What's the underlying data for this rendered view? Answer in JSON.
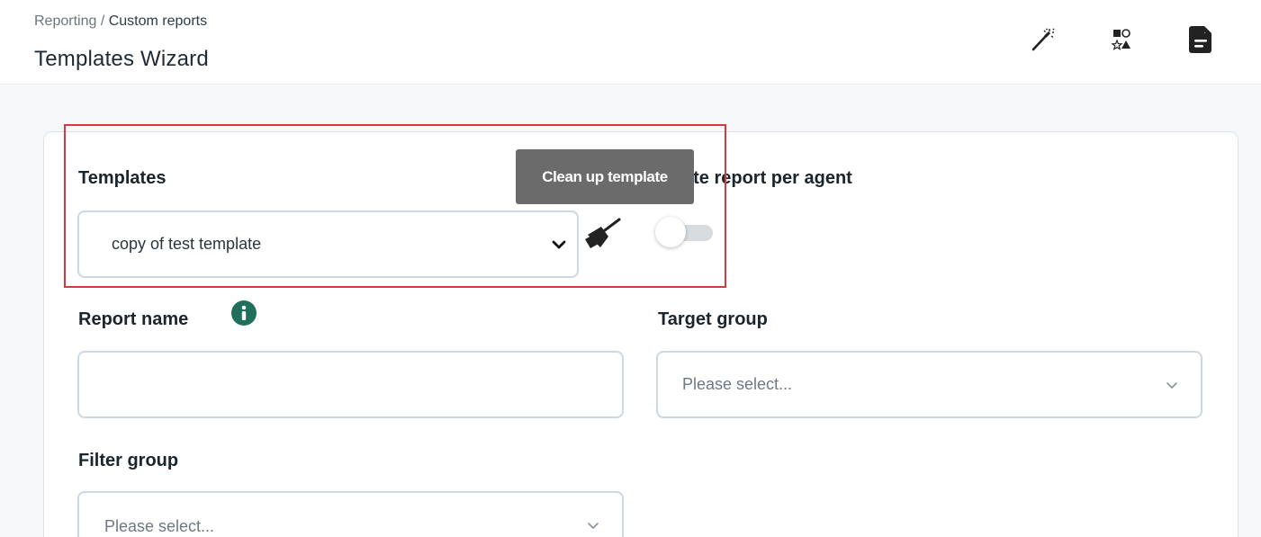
{
  "header": {
    "breadcrumb": {
      "root": "Reporting",
      "separator": " / ",
      "current": "Custom reports"
    },
    "title": "Templates Wizard",
    "toolbar": [
      {
        "icon": "magic-wand-icon"
      },
      {
        "icon": "shapes-icon"
      },
      {
        "icon": "document-icon"
      }
    ]
  },
  "form": {
    "templates": {
      "label": "Templates",
      "selected_value": "copy of test template",
      "cleanup_icon": "broom-icon",
      "cleanup_tooltip": "Clean up template"
    },
    "separate_report": {
      "label_visible": "ate report per agent",
      "toggle_on": false
    },
    "report_name": {
      "label": "Report name",
      "info_icon": "info-icon",
      "value": ""
    },
    "target_group": {
      "label": "Target group",
      "placeholder": "Please select..."
    },
    "filter_group": {
      "label": "Filter group",
      "placeholder": "Please select..."
    }
  },
  "colors": {
    "accent_teal": "#1f6f5c",
    "highlight_red": "#d9383e",
    "tooltip_bg": "#6b6b6b",
    "input_border": "#cdd8e2"
  }
}
